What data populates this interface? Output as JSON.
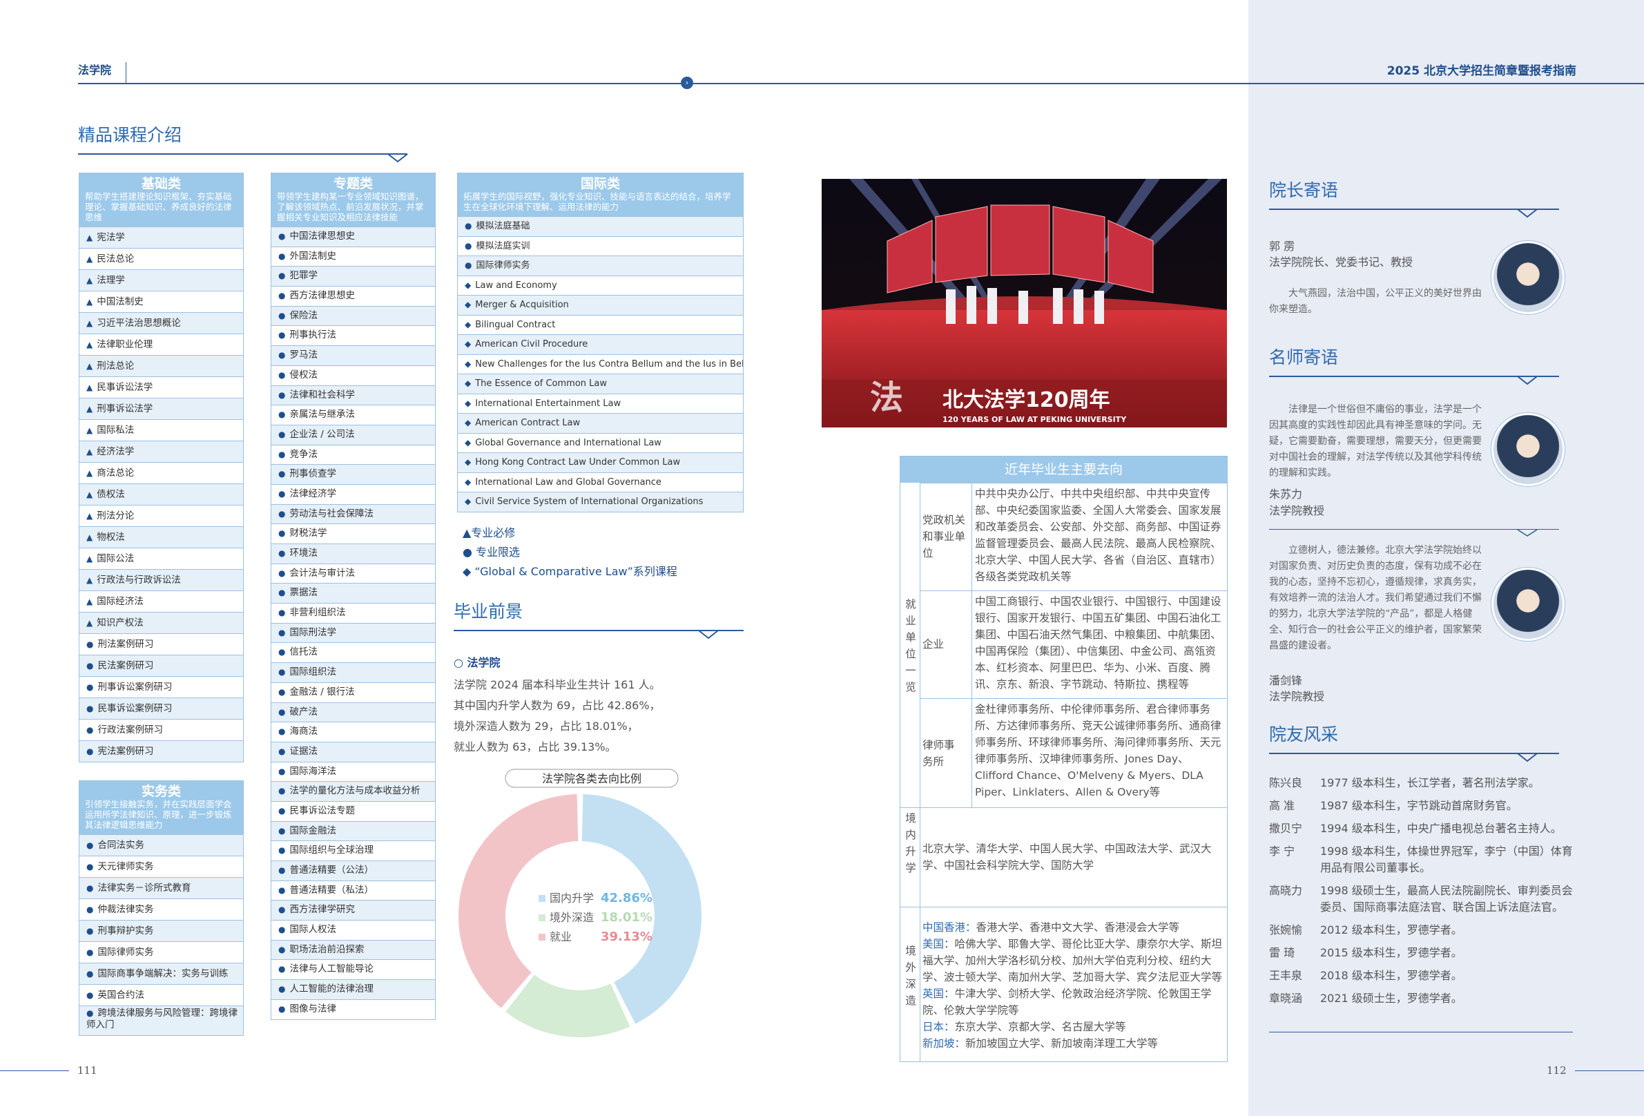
{
  "header": {
    "left": "法学院",
    "right": "2025 北京大学招生简章暨报考指南"
  },
  "courses": {
    "title": "精品课程介绍",
    "basic": {
      "title": "基础类",
      "desc": "帮助学生搭建理论知识框架、夯实基础理论、掌握基础知识、养成良好的法律思维",
      "items": [
        {
          "m": "▲",
          "t": "宪法学"
        },
        {
          "m": "▲",
          "t": "民法总论"
        },
        {
          "m": "▲",
          "t": "法理学"
        },
        {
          "m": "▲",
          "t": "中国法制史"
        },
        {
          "m": "▲",
          "t": "习近平法治思想概论"
        },
        {
          "m": "▲",
          "t": "法律职业伦理"
        },
        {
          "m": "▲",
          "t": "刑法总论"
        },
        {
          "m": "▲",
          "t": "民事诉讼法学"
        },
        {
          "m": "▲",
          "t": "刑事诉讼法学"
        },
        {
          "m": "▲",
          "t": "国际私法"
        },
        {
          "m": "▲",
          "t": "经济法学"
        },
        {
          "m": "▲",
          "t": "商法总论"
        },
        {
          "m": "▲",
          "t": "债权法"
        },
        {
          "m": "▲",
          "t": "刑法分论"
        },
        {
          "m": "▲",
          "t": "物权法"
        },
        {
          "m": "▲",
          "t": "国际公法"
        },
        {
          "m": "▲",
          "t": "行政法与行政诉讼法"
        },
        {
          "m": "▲",
          "t": "国际经济法"
        },
        {
          "m": "▲",
          "t": "知识产权法"
        },
        {
          "m": "●",
          "t": "刑法案例研习"
        },
        {
          "m": "●",
          "t": "民法案例研习"
        },
        {
          "m": "●",
          "t": "刑事诉讼案例研习"
        },
        {
          "m": "●",
          "t": "民事诉讼案例研习"
        },
        {
          "m": "●",
          "t": "行政法案例研习"
        },
        {
          "m": "●",
          "t": "宪法案例研习"
        }
      ]
    },
    "practice": {
      "title": "实务类",
      "desc": "引领学生接触实务，并在实践层面学会运用所学法律知识、原理，进一步锻炼其法律逻辑思维能力",
      "items": [
        {
          "m": "●",
          "t": "合同法实务"
        },
        {
          "m": "●",
          "t": "天元律师实务"
        },
        {
          "m": "●",
          "t": "法律实务－诊所式教育"
        },
        {
          "m": "●",
          "t": "仲裁法律实务"
        },
        {
          "m": "●",
          "t": "刑事辩护实务"
        },
        {
          "m": "●",
          "t": "国际律师实务"
        },
        {
          "m": "●",
          "t": "国际商事争端解决：实务与训练"
        },
        {
          "m": "●",
          "t": "英国合约法"
        },
        {
          "m": "●",
          "t": "跨境法律服务与风险管理：跨境律师入门"
        }
      ]
    },
    "topic": {
      "title": "专题类",
      "desc": "带领学生建构某一专业领域知识图谱，了解该领域热点、前沿发展状况，并掌握相关专业知识及相应法律技能",
      "items": [
        {
          "m": "●",
          "t": "中国法律思想史"
        },
        {
          "m": "●",
          "t": "外国法制史"
        },
        {
          "m": "●",
          "t": "犯罪学"
        },
        {
          "m": "●",
          "t": "西方法律思想史"
        },
        {
          "m": "●",
          "t": "保险法"
        },
        {
          "m": "●",
          "t": "刑事执行法"
        },
        {
          "m": "●",
          "t": "罗马法"
        },
        {
          "m": "●",
          "t": "侵权法"
        },
        {
          "m": "●",
          "t": "法律和社会科学"
        },
        {
          "m": "●",
          "t": "亲属法与继承法"
        },
        {
          "m": "●",
          "t": "企业法 / 公司法"
        },
        {
          "m": "●",
          "t": "竞争法"
        },
        {
          "m": "●",
          "t": "刑事侦查学"
        },
        {
          "m": "●",
          "t": "法律经济学"
        },
        {
          "m": "●",
          "t": "劳动法与社会保障法"
        },
        {
          "m": "●",
          "t": "财税法学"
        },
        {
          "m": "●",
          "t": "环境法"
        },
        {
          "m": "●",
          "t": "会计法与审计法"
        },
        {
          "m": "●",
          "t": "票据法"
        },
        {
          "m": "●",
          "t": "非营利组织法"
        },
        {
          "m": "●",
          "t": "国际刑法学"
        },
        {
          "m": "●",
          "t": "信托法"
        },
        {
          "m": "●",
          "t": "国际组织法"
        },
        {
          "m": "●",
          "t": "金融法 / 银行法"
        },
        {
          "m": "●",
          "t": "破产法"
        },
        {
          "m": "●",
          "t": "海商法"
        },
        {
          "m": "●",
          "t": "证据法"
        },
        {
          "m": "●",
          "t": "国际海洋法"
        },
        {
          "m": "●",
          "t": "法学的量化方法与成本收益分析"
        },
        {
          "m": "●",
          "t": "民事诉讼法专题"
        },
        {
          "m": "●",
          "t": "国际金融法"
        },
        {
          "m": "●",
          "t": "国际组织与全球治理"
        },
        {
          "m": "●",
          "t": "普通法精要（公法）"
        },
        {
          "m": "●",
          "t": "普通法精要（私法）"
        },
        {
          "m": "●",
          "t": "西方法律学研究"
        },
        {
          "m": "●",
          "t": "国际人权法"
        },
        {
          "m": "●",
          "t": "职场法治前沿探索"
        },
        {
          "m": "●",
          "t": "法律与人工智能导论"
        },
        {
          "m": "●",
          "t": "人工智能的法律治理"
        },
        {
          "m": "●",
          "t": "图像与法律"
        }
      ]
    },
    "intl": {
      "title": "国际类",
      "desc": "拓展学生的国际视野，强化专业知识、技能与语言表达的结合，培养学生在全球化环境下理解、运用法律的能力",
      "items": [
        {
          "m": "●",
          "t": "模拟法庭基础"
        },
        {
          "m": "●",
          "t": "模拟法庭实训"
        },
        {
          "m": "●",
          "t": "国际律师实务"
        },
        {
          "m": "◆",
          "t": "Law and Economy"
        },
        {
          "m": "◆",
          "t": "Merger & Acquisition"
        },
        {
          "m": "◆",
          "t": "Bilingual Contract"
        },
        {
          "m": "◆",
          "t": "American Civil Procedure"
        },
        {
          "m": "◆",
          "t": "New Challenges for the Ius Contra Bellum and the Ius in Bello"
        },
        {
          "m": "◆",
          "t": "The Essence of Common Law"
        },
        {
          "m": "◆",
          "t": "International Entertainment Law"
        },
        {
          "m": "◆",
          "t": "American Contract Law"
        },
        {
          "m": "◆",
          "t": "Global Governance and International Law"
        },
        {
          "m": "◆",
          "t": "Hong Kong Contract Law Under Common Law"
        },
        {
          "m": "◆",
          "t": "International Law and Global Governance"
        },
        {
          "m": "◆",
          "t": "Civil Service System of International Organizations"
        }
      ]
    },
    "legend": [
      "▲专业必修",
      "●  专业限选",
      "◆  “Global & Comparative Law”系列课程"
    ]
  },
  "career": {
    "title": "毕业前景",
    "school": "○ 法学院",
    "lines": [
      "法学院 2024 届本科毕业生共计 161 人。",
      "其中国内升学人数为 69，占比 42.86%，",
      "境外深造人数为 29，占比 18.01%，",
      "就业人数为 63，占比 39.13%。"
    ]
  },
  "chart_data": {
    "type": "pie",
    "title": "法学院各类去向比例",
    "categories": [
      "国内升学",
      "境外深造",
      "就业"
    ],
    "values": [
      42.86,
      18.01,
      39.13
    ],
    "value_labels": [
      "42.86%",
      "18.01%",
      "39.13%"
    ],
    "colors": [
      "#c2e0f2",
      "#d4ebd4",
      "#f2c4c8"
    ],
    "label_colors": [
      "#6fb6e0",
      "#b5d9b5",
      "#e88a93"
    ],
    "donut": true
  },
  "colors": {
    "accent": "#2b5a9b",
    "header_blue": "#9cc9ea",
    "right_panel": "#e8ecf5"
  },
  "photo": {
    "banner": "北大法学120周年",
    "banner_en": "120 YEARS OF LAW AT PEKING UNIVERSITY"
  },
  "dest_table": {
    "title": "近年毕业生主要去向",
    "employ_label": "就业单位一览",
    "rows": [
      {
        "cat": "党政机关和事业单位",
        "text": "中共中央办公厅、中共中央组织部、中共中央宣传部、中央纪委国家监委、全国人大常委会、国家发展和改革委员会、公安部、外交部、商务部、中国证券监督管理委员会、最高人民法院、最高人民检察院、北京大学、中国人民大学、各省（自治区、直辖市）各级各类党政机关等"
      },
      {
        "cat": "企业",
        "text": "中国工商银行、中国农业银行、中国银行、中国建设银行、国家开发银行、中国五矿集团、中国石油化工集团、中国石油天然气集团、中粮集团、中航集团、中国再保险（集团）、中信集团、中金公司、高瓴资本、红杉资本、阿里巴巴、华为、小米、百度、腾讯、京东、新浪、字节跳动、特斯拉、携程等"
      },
      {
        "cat": "律师事务所",
        "text": "金杜律师事务所、中伦律师事务所、君合律师事务所、方达律师事务所、竞天公诚律师事务所、通商律师事务所、环球律师事务所、海问律师事务所、天元律师事务所、汉坤律师事务所、Jones Day、Clifford Chance、O'Melveny & Myers、DLA Piper、Linklaters、Allen & Overy等"
      }
    ],
    "domestic_label": "境内升学",
    "domestic_text": "北京大学、清华大学、中国人民大学、中国政法大学、武汉大学、中国社会科学院大学、国防大学",
    "abroad_label": "境外深造",
    "abroad": [
      {
        "k": "中国香港：",
        "v": "香港大学、香港中文大学、香港浸会大学等"
      },
      {
        "k": "美国：",
        "v": "哈佛大学、耶鲁大学、哥伦比亚大学、康奈尔大学、斯坦福大学、加州大学洛杉矶分校、加州大学伯克利分校、纽约大学、波士顿大学、南加州大学、芝加哥大学、宾夕法尼亚大学等"
      },
      {
        "k": "英国：",
        "v": "牛津大学、剑桥大学、伦敦政治经济学院、伦敦国王学院、伦敦大学学院等"
      },
      {
        "k": "日本：",
        "v": "东京大学、京都大学、名古屋大学等"
      },
      {
        "k": "新加坡：",
        "v": "新加坡国立大学、新加坡南洋理工大学等"
      }
    ]
  },
  "dean": {
    "title": "院长寄语",
    "name": "郭  雳",
    "role": "法学院院长、党委书记、教授",
    "quote": "大气燕园，法治中国，公平正义的美好世界由你来塑造。"
  },
  "teachers": {
    "title": "名师寄语",
    "t1": {
      "quote": "法律是一个世俗但不庸俗的事业，法学是一个因其高度的实践性却因此具有神圣意味的学问。无疑，它需要勤奋，需要理想，需要天分，但更需要对中国社会的理解，对法学传统以及其他学科传统的理解和实践。",
      "name": "朱苏力",
      "role": "法学院教授"
    },
    "t2": {
      "quote": "立德树人，德法兼修。北京大学法学院始终以对国家负责、对历史负责的态度，保有功成不必在我的心态，坚持不忘初心，遵循规律，求真务实，有效培养一流的法治人才。我们希望通过我们不懈的努力，北京大学法学院的“产品”，都是人格健全、知行合一的社会公平正义的维护者，国家繁荣昌盛的建设者。",
      "name": "潘剑锋",
      "role": "法学院教授"
    }
  },
  "alumni": {
    "title": "院友风采",
    "items": [
      {
        "n": "陈兴良",
        "d": "1977 级本科生，长江学者，著名刑法学家。"
      },
      {
        "n": "高   准",
        "d": "1987 级本科生，字节跳动首席财务官。"
      },
      {
        "n": "撒贝宁",
        "d": "1994 级本科生，中央广播电视总台著名主持人。"
      },
      {
        "n": "李   宁",
        "d": "1998 级本科生，体操世界冠军，李宁（中国）体育用品有限公司董事长。"
      },
      {
        "n": "高晓力",
        "d": "1998 级硕士生，最高人民法院副院长、审判委员会委员、国际商事法庭法官、联合国上诉法庭法官。"
      },
      {
        "n": "张婉愉",
        "d": "2012 级本科生，罗德学者。"
      },
      {
        "n": "雷   琦",
        "d": "2015 级本科生，罗德学者。"
      },
      {
        "n": "王丰泉",
        "d": "2018 级本科生，罗德学者。"
      },
      {
        "n": "章晓涵",
        "d": "2021 级硕士生，罗德学者。"
      }
    ]
  },
  "pages": {
    "left": "111",
    "right": "112"
  }
}
